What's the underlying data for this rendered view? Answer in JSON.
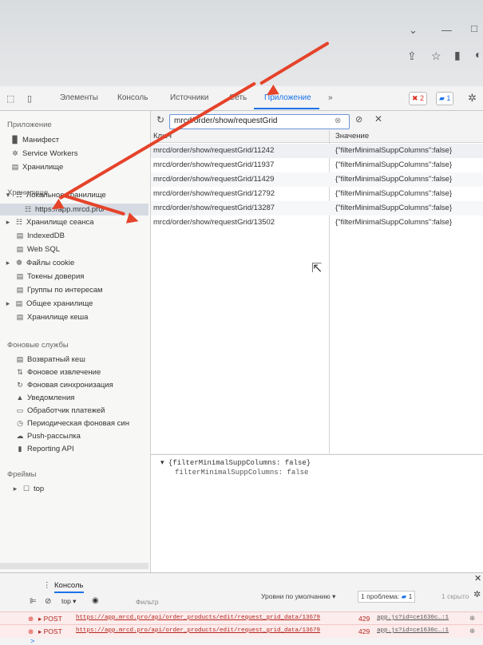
{
  "window_controls": {
    "minimize": "—",
    "maximize": "□",
    "dropdown": "⌄"
  },
  "devtools_tabs": [
    {
      "label": "Элементы"
    },
    {
      "label": "Консоль"
    },
    {
      "label": "Источники"
    },
    {
      "label": "Сеть"
    },
    {
      "label": "Приложение",
      "active": true
    },
    {
      "label": "»"
    }
  ],
  "issues": {
    "errors": "2",
    "messages": "1"
  },
  "sidebar": {
    "app_section": "Приложение",
    "app_items": [
      "Манифест",
      "Service Workers",
      "Хранилище"
    ],
    "storage_section": "Хранилище",
    "storage_items": [
      {
        "label": "Локальное хранилище",
        "expanded": true
      },
      {
        "label": "https://app.mrcd.pro/",
        "selected": true
      },
      {
        "label": "Хранилище сеанса"
      },
      {
        "label": "IndexedDB"
      },
      {
        "label": "Web SQL"
      },
      {
        "label": "Файлы cookie"
      },
      {
        "label": "Токены доверия"
      },
      {
        "label": "Группы по интересам"
      },
      {
        "label": "Общее хранилище"
      },
      {
        "label": "Хранилище кеша"
      }
    ],
    "bg_section": "Фоновые службы",
    "bg_items": [
      "Возвратный кеш",
      "Фоновое извлечение",
      "Фоновая синхронизация",
      "Уведомления",
      "Обработчик платежей",
      "Периодическая фоновая син",
      "Push-рассылка",
      "Reporting API"
    ],
    "frames_section": "Фреймы",
    "frames_items": [
      "top"
    ]
  },
  "filter": {
    "value": "mrcd/order/show/requestGrid"
  },
  "table": {
    "columns": [
      "Ключ",
      "Значение"
    ],
    "rows": [
      {
        "key": "mrcd/order/show/requestGrid/11242",
        "value": "{\"filterMinimalSuppColumns\":false}"
      },
      {
        "key": "mrcd/order/show/requestGrid/11937",
        "value": "{\"filterMinimalSuppColumns\":false}"
      },
      {
        "key": "mrcd/order/show/requestGrid/11429",
        "value": "{\"filterMinimalSuppColumns\":false}"
      },
      {
        "key": "mrcd/order/show/requestGrid/12792",
        "value": "{\"filterMinimalSuppColumns\":false}"
      },
      {
        "key": "mrcd/order/show/requestGrid/13287",
        "value": "{\"filterMinimalSuppColumns\":false}"
      },
      {
        "key": "mrcd/order/show/requestGrid/13502",
        "value": "{\"filterMinimalSuppColumns\":false}"
      }
    ]
  },
  "preview": {
    "line1": "▾ {filterMinimalSuppColumns: false}",
    "line2": "filterMinimalSuppColumns: false"
  },
  "console": {
    "tab": "Консоль",
    "context": "top ▾",
    "filter_placeholder": "Фильтр",
    "levels": "Уровни по умолчанию ▾",
    "problems": "1 проблема:",
    "problems_count": "1",
    "hidden": "1 скрыто",
    "errors": [
      {
        "method": "▸ POST",
        "url": "https://app.mrcd.pro/api/order_products/edit/request_grid_data/13679",
        "status": "429",
        "source": "app.js?id=ce1630c…:1"
      },
      {
        "method": "▸ POST",
        "url": "https://app.mrcd.pro/api/order_products/edit/request_grid_data/13679",
        "status": "429",
        "source": "app.js?id=ce1630c…:1"
      }
    ],
    "prompt": ">"
  },
  "colors": {
    "accent": "#1a73e8",
    "annotation_arrow": "#e5432a",
    "error": "#d93025"
  }
}
